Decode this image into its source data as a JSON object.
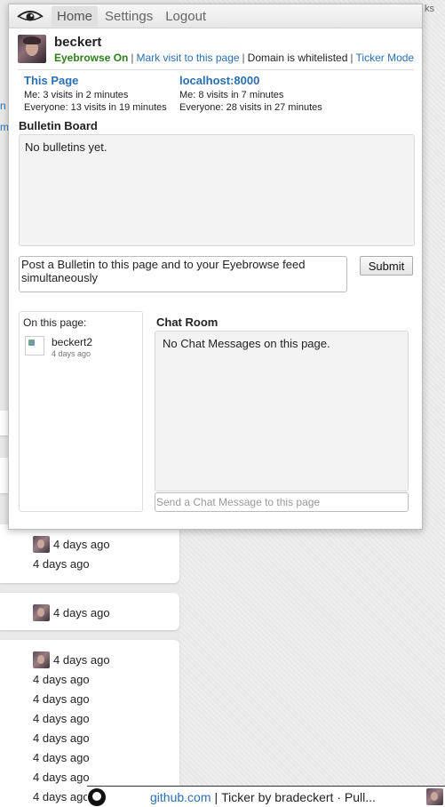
{
  "background": {
    "corner_text": "ks",
    "edge_links": [
      "n",
      "m"
    ],
    "rows": [
      {
        "time": "4 days ago",
        "with_avatar": true
      },
      {
        "time": "4 days ago",
        "with_avatar": false
      },
      {
        "time": "4 days ago",
        "with_avatar": true
      },
      {
        "time": "4 days ago",
        "with_avatar": true
      },
      {
        "time": "4 days ago",
        "with_avatar": false
      },
      {
        "time": "4 days ago",
        "with_avatar": false
      },
      {
        "time": "4 days ago",
        "with_avatar": false
      },
      {
        "time": "4 days ago",
        "with_avatar": false
      },
      {
        "time": "4 days ago",
        "with_avatar": false
      },
      {
        "time": "4 days ago",
        "with_avatar": false
      },
      {
        "time": "4 days ago",
        "with_avatar": false
      }
    ]
  },
  "ticker": {
    "link": "github.com",
    "text": "Ticker by bradeckert · Pull..."
  },
  "nav": {
    "items": [
      "Home",
      "Settings",
      "Logout"
    ]
  },
  "profile": {
    "username": "beckert",
    "status": "Eyebrowse On",
    "mark_visit": "Mark visit to this page",
    "domain_status": "Domain is whitelisted",
    "ticker_mode": "Ticker Mode"
  },
  "stats": {
    "page": {
      "title": "This Page",
      "me": "Me: 3 visits in 2 minutes",
      "everyone": "Everyone: 13 visits in 19 minutes"
    },
    "domain": {
      "title": "localhost:8000",
      "me": "Me: 8 visits in 7 minutes",
      "everyone": "Everyone: 28 visits in 27 minutes"
    }
  },
  "bulletin": {
    "title": "Bulletin Board",
    "empty": "No bulletins yet.",
    "input_value": "Post a Bulletin to this page and to your Eyebrowse feed simultaneously",
    "submit": "Submit"
  },
  "on_page": {
    "label": "On this page:",
    "users": [
      {
        "name": "beckert2",
        "ago": "4 days ago"
      }
    ]
  },
  "chat": {
    "title": "Chat Room",
    "empty": "No Chat Messages on this page.",
    "placeholder": "Send a Chat Message to this page"
  },
  "colors": {
    "link": "#2a6fb3",
    "status_on": "#2e7d1b",
    "panel_bg": "#f3f3f3"
  }
}
